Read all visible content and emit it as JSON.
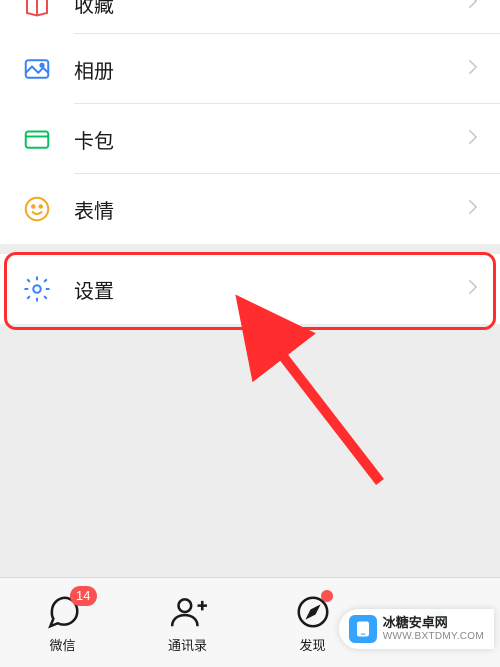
{
  "menu": {
    "favorites": {
      "label": "收藏"
    },
    "album": {
      "label": "相册"
    },
    "cards": {
      "label": "卡包"
    },
    "stickers": {
      "label": "表情"
    },
    "settings": {
      "label": "设置"
    }
  },
  "tabs": {
    "chats": {
      "label": "微信",
      "badge": "14"
    },
    "contacts": {
      "label": "通讯录"
    },
    "discover": {
      "label": "发现"
    }
  },
  "watermark": {
    "title": "冰糖安卓网",
    "url": "WWW.BXTDMY.COM"
  },
  "colors": {
    "highlight": "#ff2d2d",
    "badge": "#fa5151",
    "accent": "#07c160",
    "settings_icon": "#3b82f6",
    "sticker_icon": "#f5a623",
    "album_icon": "#3b82f6",
    "cards_icon": "#07c160",
    "favorites_icon": "#ef4d4d"
  }
}
